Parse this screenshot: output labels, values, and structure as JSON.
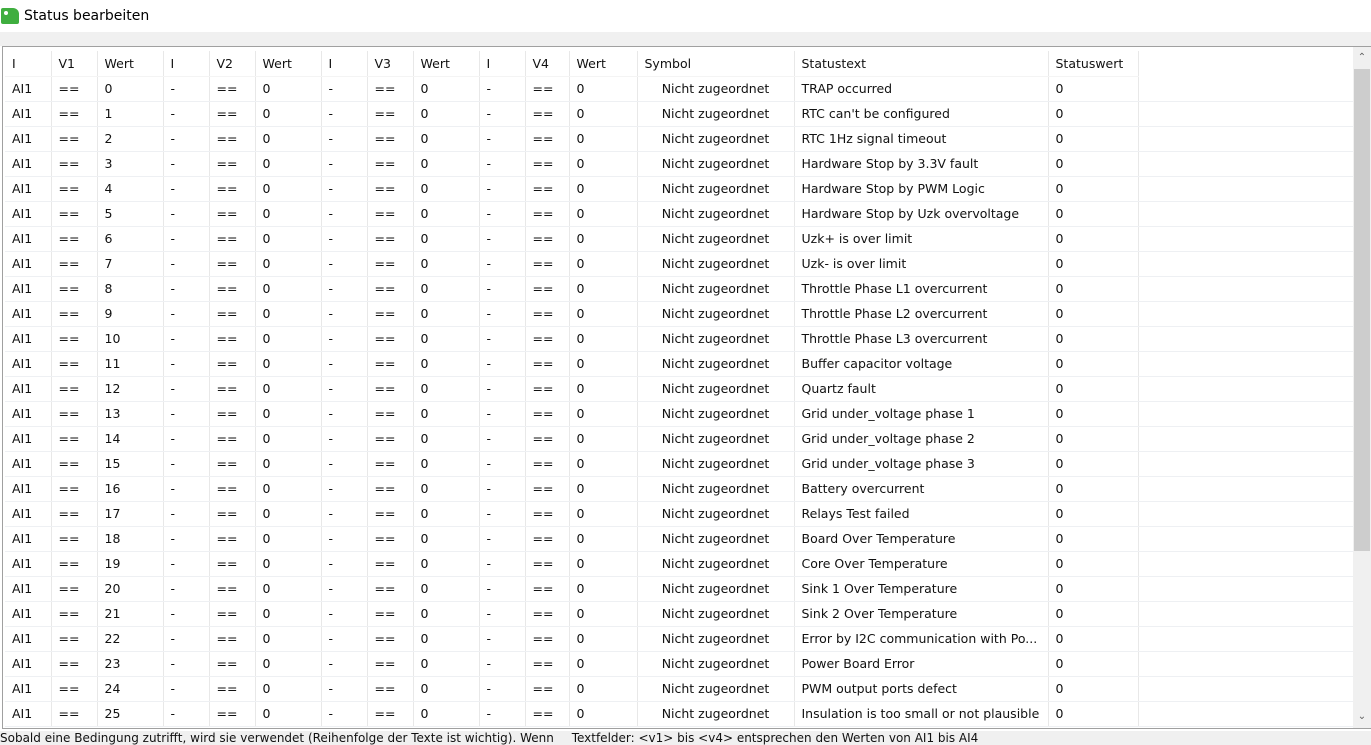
{
  "window": {
    "title": "Status bearbeiten"
  },
  "table": {
    "headers": [
      "I",
      "V1",
      "Wert",
      "I",
      "V2",
      "Wert",
      "I",
      "V3",
      "Wert",
      "I",
      "V4",
      "Wert",
      "Symbol",
      "Statustext",
      "Statuswert"
    ],
    "rows": [
      [
        "AI1",
        "==",
        "0",
        "-",
        "==",
        "0",
        "-",
        "==",
        "0",
        "-",
        "==",
        "0",
        "Nicht zugeordnet",
        "TRAP occurred",
        "0"
      ],
      [
        "AI1",
        "==",
        "1",
        "-",
        "==",
        "0",
        "-",
        "==",
        "0",
        "-",
        "==",
        "0",
        "Nicht zugeordnet",
        "RTC can't be configured",
        "0"
      ],
      [
        "AI1",
        "==",
        "2",
        "-",
        "==",
        "0",
        "-",
        "==",
        "0",
        "-",
        "==",
        "0",
        "Nicht zugeordnet",
        "RTC 1Hz signal timeout",
        "0"
      ],
      [
        "AI1",
        "==",
        "3",
        "-",
        "==",
        "0",
        "-",
        "==",
        "0",
        "-",
        "==",
        "0",
        "Nicht zugeordnet",
        "Hardware Stop by 3.3V fault",
        "0"
      ],
      [
        "AI1",
        "==",
        "4",
        "-",
        "==",
        "0",
        "-",
        "==",
        "0",
        "-",
        "==",
        "0",
        "Nicht zugeordnet",
        "Hardware Stop by PWM Logic",
        "0"
      ],
      [
        "AI1",
        "==",
        "5",
        "-",
        "==",
        "0",
        "-",
        "==",
        "0",
        "-",
        "==",
        "0",
        "Nicht zugeordnet",
        "Hardware Stop by Uzk overvoltage",
        "0"
      ],
      [
        "AI1",
        "==",
        "6",
        "-",
        "==",
        "0",
        "-",
        "==",
        "0",
        "-",
        "==",
        "0",
        "Nicht zugeordnet",
        "Uzk+ is over limit",
        "0"
      ],
      [
        "AI1",
        "==",
        "7",
        "-",
        "==",
        "0",
        "-",
        "==",
        "0",
        "-",
        "==",
        "0",
        "Nicht zugeordnet",
        "Uzk- is over limit",
        "0"
      ],
      [
        "AI1",
        "==",
        "8",
        "-",
        "==",
        "0",
        "-",
        "==",
        "0",
        "-",
        "==",
        "0",
        "Nicht zugeordnet",
        "Throttle Phase L1 overcurrent",
        "0"
      ],
      [
        "AI1",
        "==",
        "9",
        "-",
        "==",
        "0",
        "-",
        "==",
        "0",
        "-",
        "==",
        "0",
        "Nicht zugeordnet",
        "Throttle Phase L2 overcurrent",
        "0"
      ],
      [
        "AI1",
        "==",
        "10",
        "-",
        "==",
        "0",
        "-",
        "==",
        "0",
        "-",
        "==",
        "0",
        "Nicht zugeordnet",
        "Throttle Phase L3 overcurrent",
        "0"
      ],
      [
        "AI1",
        "==",
        "11",
        "-",
        "==",
        "0",
        "-",
        "==",
        "0",
        "-",
        "==",
        "0",
        "Nicht zugeordnet",
        "Buffer capacitor voltage",
        "0"
      ],
      [
        "AI1",
        "==",
        "12",
        "-",
        "==",
        "0",
        "-",
        "==",
        "0",
        "-",
        "==",
        "0",
        "Nicht zugeordnet",
        "Quartz fault",
        "0"
      ],
      [
        "AI1",
        "==",
        "13",
        "-",
        "==",
        "0",
        "-",
        "==",
        "0",
        "-",
        "==",
        "0",
        "Nicht zugeordnet",
        "Grid under_voltage phase 1",
        "0"
      ],
      [
        "AI1",
        "==",
        "14",
        "-",
        "==",
        "0",
        "-",
        "==",
        "0",
        "-",
        "==",
        "0",
        "Nicht zugeordnet",
        "Grid under_voltage phase 2",
        "0"
      ],
      [
        "AI1",
        "==",
        "15",
        "-",
        "==",
        "0",
        "-",
        "==",
        "0",
        "-",
        "==",
        "0",
        "Nicht zugeordnet",
        "Grid under_voltage phase 3",
        "0"
      ],
      [
        "AI1",
        "==",
        "16",
        "-",
        "==",
        "0",
        "-",
        "==",
        "0",
        "-",
        "==",
        "0",
        "Nicht zugeordnet",
        "Battery overcurrent",
        "0"
      ],
      [
        "AI1",
        "==",
        "17",
        "-",
        "==",
        "0",
        "-",
        "==",
        "0",
        "-",
        "==",
        "0",
        "Nicht zugeordnet",
        "Relays Test failed",
        "0"
      ],
      [
        "AI1",
        "==",
        "18",
        "-",
        "==",
        "0",
        "-",
        "==",
        "0",
        "-",
        "==",
        "0",
        "Nicht zugeordnet",
        "Board Over Temperature",
        "0"
      ],
      [
        "AI1",
        "==",
        "19",
        "-",
        "==",
        "0",
        "-",
        "==",
        "0",
        "-",
        "==",
        "0",
        "Nicht zugeordnet",
        "Core Over Temperature",
        "0"
      ],
      [
        "AI1",
        "==",
        "20",
        "-",
        "==",
        "0",
        "-",
        "==",
        "0",
        "-",
        "==",
        "0",
        "Nicht zugeordnet",
        "Sink 1 Over Temperature",
        "0"
      ],
      [
        "AI1",
        "==",
        "21",
        "-",
        "==",
        "0",
        "-",
        "==",
        "0",
        "-",
        "==",
        "0",
        "Nicht zugeordnet",
        "Sink 2 Over Temperature",
        "0"
      ],
      [
        "AI1",
        "==",
        "22",
        "-",
        "==",
        "0",
        "-",
        "==",
        "0",
        "-",
        "==",
        "0",
        "Nicht zugeordnet",
        "Error by I2C communication with Po...",
        "0"
      ],
      [
        "AI1",
        "==",
        "23",
        "-",
        "==",
        "0",
        "-",
        "==",
        "0",
        "-",
        "==",
        "0",
        "Nicht zugeordnet",
        "Power Board Error",
        "0"
      ],
      [
        "AI1",
        "==",
        "24",
        "-",
        "==",
        "0",
        "-",
        "==",
        "0",
        "-",
        "==",
        "0",
        "Nicht zugeordnet",
        "PWM output ports defect",
        "0"
      ],
      [
        "AI1",
        "==",
        "25",
        "-",
        "==",
        "0",
        "-",
        "==",
        "0",
        "-",
        "==",
        "0",
        "Nicht zugeordnet",
        "Insulation is too small or not plausible",
        "0"
      ]
    ]
  },
  "scrollbar": {
    "up_icon": "chevron-up-icon",
    "down_icon": "chevron-down-icon",
    "up_glyph": "⌃",
    "down_glyph": "⌄"
  },
  "statusbar": {
    "hint": "Sobald eine Bedingung zutrifft, wird sie verwendet (Reihenfolge der Texte ist wichtig). Wenn",
    "textfields": "Textfelder: <v1> bis <v4> entsprechen den Werten von AI1 bis AI4"
  }
}
